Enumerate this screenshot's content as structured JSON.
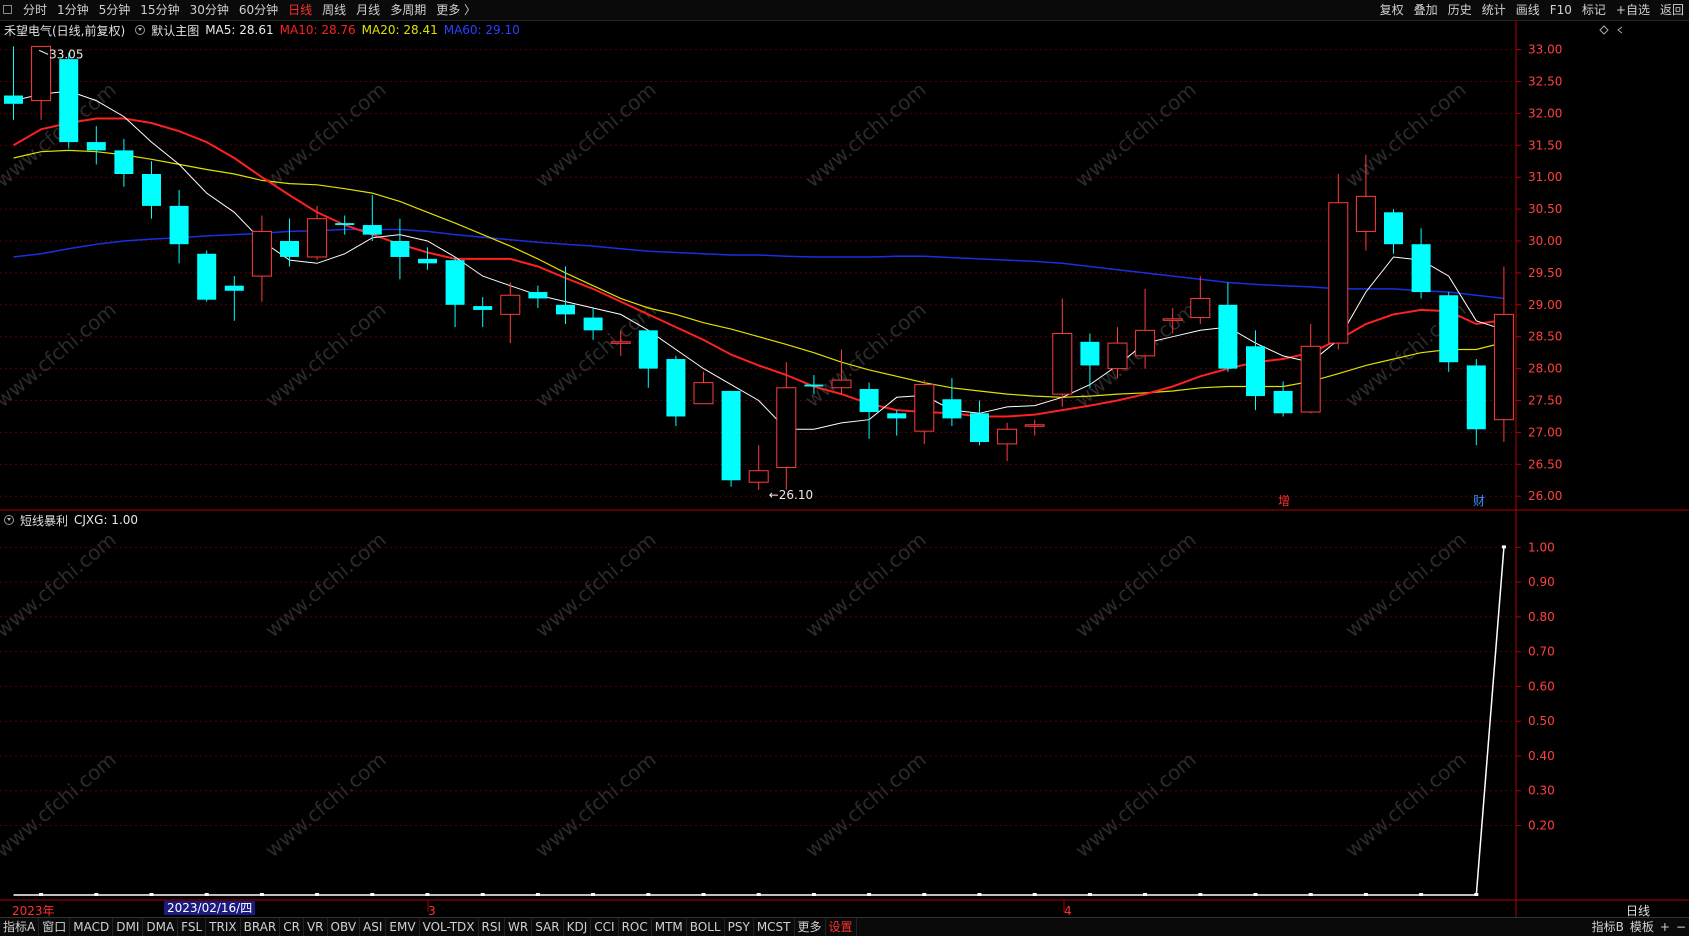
{
  "toolbar": {
    "tabs": [
      "分时",
      "1分钟",
      "5分钟",
      "15分钟",
      "30分钟",
      "60分钟",
      "日线",
      "周线",
      "月线",
      "多周期",
      "更多 〉"
    ],
    "active_tab": "日线",
    "right_buttons": [
      "复权",
      "叠加",
      "历史",
      "统计",
      "画线",
      "F10",
      "标记",
      "+自选",
      "返回"
    ]
  },
  "info": {
    "stock": "禾望电气(日线,前复权)",
    "main_chart": "默认主图",
    "ma5": "MA5: 28.61",
    "ma10": "MA10: 28.76",
    "ma20": "MA20: 28.41",
    "ma60": "MA60: 29.10"
  },
  "indicator": {
    "name": "短线暴利",
    "value": "CJXG: 1.00"
  },
  "markers": {
    "high_label": "33.05",
    "low_label": "←26.10",
    "zeng": "增",
    "cai": "财"
  },
  "xaxis": {
    "start_label": "2023年",
    "date_flag": "2023/02/16/四",
    "month3": "3",
    "month4": "4",
    "period_label": "日线"
  },
  "watermark": "www.cfchi.com",
  "colors": {
    "up": "#ff3c3c",
    "down": "#00ffff",
    "ma5": "#ffffff",
    "ma10": "#ff2020",
    "ma20": "#e0e000",
    "ma60": "#1a2fe0",
    "axis": "#b00000",
    "grid": "#5a0000"
  },
  "bottom_tabs": [
    "指标A",
    "窗口",
    "MACD",
    "DMI",
    "DMA",
    "FSL",
    "TRIX",
    "BRAR",
    "CR",
    "VR",
    "OBV",
    "ASI",
    "EMV",
    "VOL-TDX",
    "RSI",
    "WR",
    "SAR",
    "KDJ",
    "CCI",
    "ROC",
    "MTM",
    "BOLL",
    "PSY",
    "MCST",
    "更多",
    "设置"
  ],
  "bottom_active": "设置",
  "bottom_right": [
    "指标B",
    "模板",
    "+",
    "−"
  ],
  "chart_data": {
    "type": "candlestick",
    "price_axis": {
      "ylim": [
        25.8,
        33.15
      ],
      "ticks": [
        26.0,
        26.5,
        27.0,
        27.5,
        28.0,
        28.5,
        29.0,
        29.5,
        30.0,
        30.5,
        31.0,
        31.5,
        32.0,
        32.5,
        33.0
      ]
    },
    "candles": [
      [
        32.28,
        32.15,
        33.05,
        31.9
      ],
      [
        32.2,
        33.05,
        33.05,
        31.9
      ],
      [
        32.85,
        31.55,
        32.95,
        31.45
      ],
      [
        31.55,
        31.42,
        31.8,
        31.2
      ],
      [
        31.42,
        31.05,
        31.6,
        30.85
      ],
      [
        31.05,
        30.55,
        31.25,
        30.35
      ],
      [
        30.55,
        29.95,
        30.8,
        29.65
      ],
      [
        29.8,
        29.08,
        29.85,
        29.05
      ],
      [
        29.3,
        29.22,
        29.45,
        28.75
      ],
      [
        29.45,
        30.15,
        30.4,
        29.05
      ],
      [
        30.0,
        29.75,
        30.35,
        29.6
      ],
      [
        29.75,
        30.35,
        30.55,
        29.7
      ],
      [
        30.28,
        30.25,
        30.4,
        30.1
      ],
      [
        30.25,
        30.1,
        30.72,
        30.0
      ],
      [
        30.0,
        29.75,
        30.35,
        29.4
      ],
      [
        29.72,
        29.65,
        29.9,
        29.55
      ],
      [
        29.7,
        29.0,
        29.75,
        28.65
      ],
      [
        28.98,
        28.92,
        29.12,
        28.65
      ],
      [
        28.85,
        29.15,
        29.35,
        28.4
      ],
      [
        29.2,
        29.1,
        29.3,
        28.95
      ],
      [
        29.0,
        28.85,
        29.6,
        28.7
      ],
      [
        28.8,
        28.6,
        28.95,
        28.45
      ],
      [
        28.42,
        28.42,
        28.6,
        28.2
      ],
      [
        28.6,
        28.0,
        28.6,
        27.7
      ],
      [
        28.15,
        27.25,
        28.2,
        27.1
      ],
      [
        27.45,
        27.78,
        27.95,
        27.45
      ],
      [
        27.65,
        26.25,
        27.65,
        26.15
      ],
      [
        26.22,
        26.4,
        26.8,
        26.1
      ],
      [
        26.45,
        27.7,
        28.1,
        26.1
      ],
      [
        27.75,
        27.72,
        27.9,
        27.6
      ],
      [
        27.7,
        27.82,
        28.3,
        27.6
      ],
      [
        27.68,
        27.32,
        27.78,
        26.9
      ],
      [
        27.3,
        27.22,
        27.35,
        26.95
      ],
      [
        27.02,
        27.75,
        27.82,
        26.82
      ],
      [
        27.52,
        27.22,
        27.85,
        27.1
      ],
      [
        27.3,
        26.85,
        27.5,
        26.8
      ],
      [
        26.82,
        27.05,
        27.15,
        26.55
      ],
      [
        27.1,
        27.12,
        27.2,
        26.95
      ],
      [
        27.6,
        28.55,
        29.1,
        27.4
      ],
      [
        28.42,
        28.05,
        28.55,
        27.7
      ],
      [
        28.0,
        28.4,
        28.65,
        27.85
      ],
      [
        28.2,
        28.6,
        29.25,
        28.0
      ],
      [
        28.78,
        28.78,
        28.95,
        28.55
      ],
      [
        28.8,
        29.1,
        29.45,
        28.7
      ],
      [
        29.0,
        28.0,
        29.35,
        27.95
      ],
      [
        28.35,
        27.57,
        28.6,
        27.35
      ],
      [
        27.65,
        27.3,
        27.8,
        27.25
      ],
      [
        27.32,
        28.35,
        28.7,
        27.3
      ],
      [
        28.4,
        30.6,
        31.05,
        28.3
      ],
      [
        30.15,
        30.7,
        31.35,
        29.85
      ],
      [
        30.45,
        29.95,
        30.5,
        29.8
      ],
      [
        29.95,
        29.2,
        30.2,
        29.1
      ],
      [
        29.15,
        28.1,
        29.2,
        27.95
      ],
      [
        28.05,
        27.05,
        28.15,
        26.8
      ],
      [
        27.2,
        28.85,
        29.6,
        26.85
      ]
    ],
    "ma5": [
      32.2,
      32.3,
      32.35,
      32.2,
      31.95,
      31.55,
      31.2,
      30.75,
      30.45,
      30.0,
      29.7,
      29.65,
      29.8,
      30.05,
      30.1,
      30.0,
      29.75,
      29.45,
      29.3,
      29.15,
      29.05,
      28.95,
      28.85,
      28.6,
      28.3,
      28.0,
      27.75,
      27.5,
      27.05,
      27.05,
      27.15,
      27.2,
      27.55,
      27.58,
      27.35,
      27.3,
      27.4,
      27.42,
      27.55,
      27.75,
      28.05,
      28.4,
      28.5,
      28.6,
      28.65,
      28.4,
      28.2,
      28.1,
      28.45,
      29.2,
      29.75,
      29.7,
      29.45,
      28.75,
      28.61
    ],
    "ma10": [
      31.5,
      31.75,
      31.85,
      31.92,
      31.92,
      31.85,
      31.72,
      31.55,
      31.3,
      31.0,
      30.72,
      30.45,
      30.25,
      30.1,
      29.95,
      29.82,
      29.72,
      29.72,
      29.72,
      29.6,
      29.42,
      29.25,
      29.05,
      28.85,
      28.65,
      28.45,
      28.22,
      28.05,
      27.9,
      27.72,
      27.6,
      27.45,
      27.35,
      27.32,
      27.3,
      27.25,
      27.25,
      27.28,
      27.35,
      27.42,
      27.5,
      27.6,
      27.72,
      27.88,
      28.0,
      28.1,
      28.15,
      28.25,
      28.45,
      28.7,
      28.85,
      28.92,
      28.9,
      28.7,
      28.76
    ],
    "ma20": [
      31.3,
      31.4,
      31.42,
      31.4,
      31.35,
      31.28,
      31.2,
      31.12,
      31.05,
      30.95,
      30.9,
      30.88,
      30.82,
      30.75,
      30.62,
      30.45,
      30.28,
      30.1,
      29.92,
      29.72,
      29.5,
      29.3,
      29.1,
      28.95,
      28.85,
      28.72,
      28.62,
      28.5,
      28.38,
      28.25,
      28.1,
      27.98,
      27.88,
      27.78,
      27.7,
      27.65,
      27.6,
      27.57,
      27.55,
      27.57,
      27.6,
      27.62,
      27.65,
      27.7,
      27.72,
      27.72,
      27.72,
      27.8,
      27.92,
      28.05,
      28.15,
      28.25,
      28.3,
      28.3,
      28.41
    ],
    "ma60": [
      29.75,
      29.8,
      29.88,
      29.95,
      30.0,
      30.03,
      30.05,
      30.08,
      30.1,
      30.12,
      30.15,
      30.16,
      30.18,
      30.18,
      30.18,
      30.15,
      30.1,
      30.06,
      30.02,
      29.98,
      29.95,
      29.92,
      29.88,
      29.84,
      29.82,
      29.8,
      29.78,
      29.78,
      29.76,
      29.75,
      29.75,
      29.75,
      29.76,
      29.76,
      29.74,
      29.72,
      29.7,
      29.68,
      29.65,
      29.6,
      29.55,
      29.5,
      29.45,
      29.4,
      29.35,
      29.32,
      29.3,
      29.28,
      29.25,
      29.25,
      29.25,
      29.22,
      29.2,
      29.15,
      29.1
    ],
    "indicator": {
      "name": "CJXG",
      "ylim": [
        0,
        1.05
      ],
      "ticks": [
        0.2,
        0.3,
        0.4,
        0.5,
        0.6,
        0.7,
        0.8,
        0.9,
        1.0
      ],
      "values": [
        0,
        0,
        0,
        0,
        0,
        0,
        0,
        0,
        0,
        0,
        0,
        0,
        0,
        0,
        0,
        0,
        0,
        0,
        0,
        0,
        0,
        0,
        0,
        0,
        0,
        0,
        0,
        0,
        0,
        0,
        0,
        0,
        0,
        0,
        0,
        0,
        0,
        0,
        0,
        0,
        0,
        0,
        0,
        0,
        0,
        0,
        0,
        0,
        0,
        0,
        0,
        0,
        0,
        0,
        1
      ]
    }
  }
}
